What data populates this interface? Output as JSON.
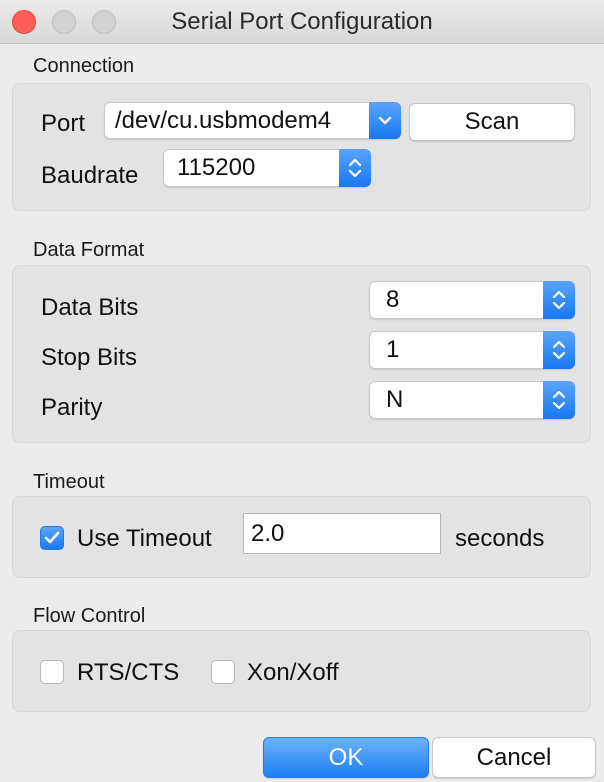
{
  "window": {
    "title": "Serial Port Configuration"
  },
  "connection": {
    "section_label": "Connection",
    "port_label": "Port",
    "port_value": "/dev/cu.usbmodem4",
    "scan_label": "Scan",
    "baudrate_label": "Baudrate",
    "baudrate_value": "115200"
  },
  "data_format": {
    "section_label": "Data Format",
    "data_bits_label": "Data Bits",
    "data_bits_value": "8",
    "stop_bits_label": "Stop Bits",
    "stop_bits_value": "1",
    "parity_label": "Parity",
    "parity_value": "N"
  },
  "timeout": {
    "section_label": "Timeout",
    "use_timeout_label": "Use Timeout",
    "use_timeout_checked": true,
    "timeout_value": "2.0",
    "unit_label": "seconds"
  },
  "flow_control": {
    "section_label": "Flow Control",
    "rtscts_label": "RTS/CTS",
    "rtscts_checked": false,
    "xonxoff_label": "Xon/Xoff",
    "xonxoff_checked": false
  },
  "buttons": {
    "ok_label": "OK",
    "cancel_label": "Cancel"
  },
  "colors": {
    "accent": "#1d7ef4",
    "close_button": "#fc5f57",
    "group_background": "#e3e3e3",
    "window_background": "#ececec"
  }
}
